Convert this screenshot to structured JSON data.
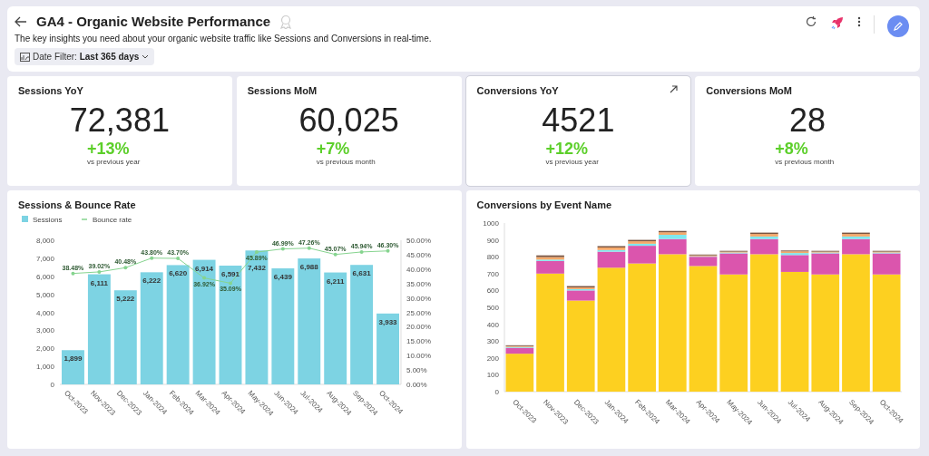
{
  "header": {
    "title": "GA4 - Organic Website Performance",
    "subtitle": "The key insights you need about your organic website traffic like Sessions and Conversions in real-time.",
    "date_filter": "Date Filter: **Last 365 days**"
  },
  "kpis": [
    {
      "title": "Sessions YoY",
      "value": "72,381",
      "delta": "+13%",
      "caption": "vs previous year",
      "expandable": false
    },
    {
      "title": "Sessions MoM",
      "value": "60,025",
      "delta": "+7%",
      "caption": "vs previous month",
      "expandable": false
    },
    {
      "title": "Conversions YoY",
      "value": "4521",
      "delta": "+12%",
      "caption": "vs previous year",
      "expandable": true
    },
    {
      "title": "Conversions MoM",
      "value": "28",
      "delta": "+8%",
      "caption": "vs previous month",
      "expandable": false
    }
  ],
  "sessions_chart": {
    "title": "Sessions & Bounce Rate",
    "chart_data": {
      "type": "bar",
      "categories": [
        "Oct-2023",
        "Nov-2023",
        "Dec-2023",
        "Jan-2024",
        "Feb-2024",
        "Mar-2024",
        "Apr-2024",
        "May-2024",
        "Jun-2024",
        "Jul-2024",
        "Aug-2024",
        "Sep-2024",
        "Oct-2024"
      ],
      "series": [
        {
          "name": "Sessions",
          "type": "bar",
          "color": "#7dd3e3",
          "values": [
            1899,
            6111,
            5222,
            6222,
            6620,
            6914,
            6591,
            7432,
            6439,
            6988,
            6211,
            6631,
            3933
          ],
          "value_labels": [
            "1,899",
            "6,111",
            "5,222",
            "6,222",
            "6,620",
            "6,914",
            "6,591",
            "7,432",
            "6,439",
            "6,988",
            "6,211",
            "6,631",
            "3,933"
          ]
        },
        {
          "name": "Bounce rate",
          "type": "line",
          "axis": "y2",
          "color": "#86d48f",
          "values": [
            38.48,
            39.02,
            40.48,
            43.8,
            43.7,
            36.92,
            35.09,
            45.89,
            46.99,
            47.26,
            45.07,
            45.94,
            46.3
          ],
          "value_labels": [
            "38.48%",
            "39.02%",
            "40.48%",
            "43.80%",
            "43.70%",
            "36.92%",
            "35.09%",
            "45.89%",
            "46.99%",
            "47.26%",
            "45.07%",
            "45.94%",
            "46.30%"
          ]
        }
      ],
      "ylim": [
        0,
        8000
      ],
      "yticks": [
        {
          "value": 0,
          "label": "0"
        },
        {
          "value": 1000,
          "label": "1,000"
        },
        {
          "value": 2000,
          "label": "2,000"
        },
        {
          "value": 3000,
          "label": "3,000"
        },
        {
          "value": 4000,
          "label": "4,000"
        },
        {
          "value": 5000,
          "label": "5,000"
        },
        {
          "value": 6000,
          "label": "6,000"
        },
        {
          "value": 7000,
          "label": "7,000"
        },
        {
          "value": 8000,
          "label": "8,000"
        }
      ],
      "legend": "top-left",
      "y2lim": [
        0,
        50
      ],
      "y2ticks": [
        {
          "value": 0,
          "label": "0.00%"
        },
        {
          "value": 5,
          "label": "5.00%"
        },
        {
          "value": 10,
          "label": "10.00%"
        },
        {
          "value": 15,
          "label": "15.00%"
        },
        {
          "value": 20,
          "label": "20.00%"
        },
        {
          "value": 25,
          "label": "25.00%"
        },
        {
          "value": 30,
          "label": "30.00%"
        },
        {
          "value": 35,
          "label": "35.00%"
        },
        {
          "value": 40,
          "label": "40.00%"
        },
        {
          "value": 45,
          "label": "45.00%"
        },
        {
          "value": 50,
          "label": "50.00%"
        }
      ],
      "data_labels": true
    }
  },
  "conversions_chart": {
    "title": "Conversions by Event Name",
    "chart_data": {
      "type": "bar",
      "stacked": true,
      "categories": [
        "Oct-2023",
        "Nov-2023",
        "Dec-2023",
        "Jan-2024",
        "Feb-2024",
        "Mar-2024",
        "Apr-2024",
        "May-2024",
        "Jun-2024",
        "Jul-2024",
        "Aug-2024",
        "Sep-2024",
        "Oct-2024"
      ],
      "series": [
        {
          "color": "#fdd020",
          "values": [
            225,
            700,
            540,
            735,
            760,
            815,
            745,
            695,
            815,
            710,
            695,
            815,
            695
          ]
        },
        {
          "color": "#db55ad",
          "values": [
            35,
            75,
            60,
            95,
            105,
            90,
            55,
            125,
            90,
            100,
            125,
            90,
            125
          ]
        },
        {
          "color": "#7ee8f0",
          "values": [
            5,
            8,
            8,
            10,
            12,
            25,
            3,
            5,
            15,
            12,
            5,
            15,
            5
          ]
        },
        {
          "color": "#f5a96a",
          "values": [
            5,
            15,
            10,
            15,
            15,
            15,
            5,
            5,
            15,
            10,
            5,
            15,
            5
          ]
        },
        {
          "color": "#7a5540",
          "values": [
            5,
            10,
            8,
            8,
            8,
            8,
            5,
            5,
            8,
            5,
            5,
            8,
            5
          ]
        }
      ],
      "ylim": [
        0,
        1000
      ],
      "yticks": [
        0,
        100,
        200,
        300,
        400,
        500,
        600,
        700,
        800,
        900,
        1000
      ]
    }
  }
}
